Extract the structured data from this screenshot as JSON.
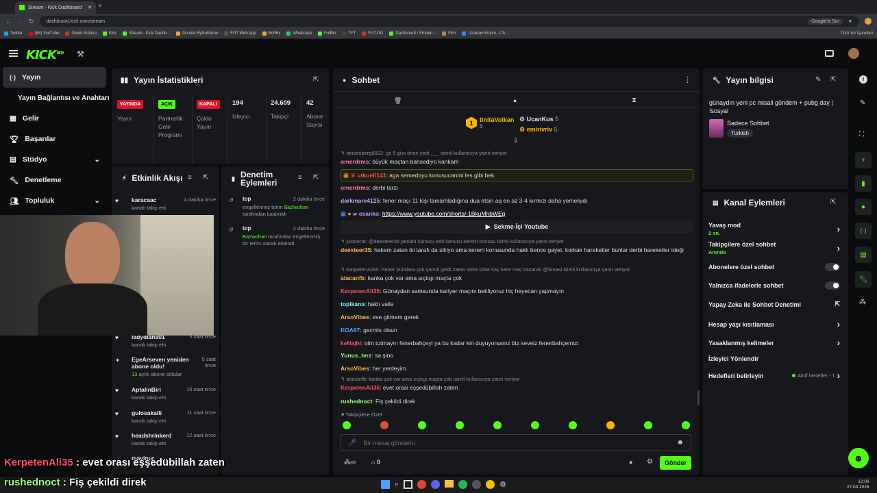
{
  "browser": {
    "tab_title": "Stream - Kick Dashboard",
    "url": "dashboard.kick.com/stream",
    "google_label": "Google'a Sor",
    "bookmarks": [
      "Twitter",
      "(88) YouTube",
      "Gelen Kutusu",
      "Kick",
      "Stream - Kick Dashb...",
      "Donate ByNoGame",
      "FUT Web App",
      "BotRix",
      "WhatsApp",
      "FutBin",
      "TFT",
      "FUT.GG",
      "Dashboard / Stream...",
      "Film",
      "Uzaktan Erişim - Ch..."
    ],
    "all_bookmarks": "Tüm Yer İşaretleri"
  },
  "app": {
    "logo": "KICK",
    "logo_sup": "BETA"
  },
  "sidebar": {
    "items": [
      {
        "label": "Yayın"
      },
      {
        "label": "Yayın Bağlantısı ve Anahtarı"
      },
      {
        "label": "Gelir"
      },
      {
        "label": "Başarılar"
      },
      {
        "label": "Stüdyo"
      },
      {
        "label": "Denetleme"
      },
      {
        "label": "Topluluk"
      }
    ]
  },
  "stats": {
    "title": "Yayın İstatistikleri",
    "cols": [
      {
        "badge": "YAYINDA",
        "label": "Yayın"
      },
      {
        "badge": "AÇIK",
        "label": "Partnerlik Gelir Programı"
      },
      {
        "badge": "KAPALI",
        "label": "Çoklu Yayın"
      },
      {
        "value": "194",
        "label": "İzleyici"
      },
      {
        "value": "24.609",
        "label": "Takipçi"
      },
      {
        "value": "42",
        "label": "Abone Sayısı"
      }
    ]
  },
  "activity": {
    "title": "Etkinlik Akışı",
    "items": [
      {
        "name": "karacaac",
        "sub": "kanalı takip etti",
        "time": "4 dakika önce"
      },
      {
        "name": "ladydiana01",
        "sub": "kanalı takip etti",
        "time": "3 saat önce"
      },
      {
        "name": "EgeArseven yeniden abone oldu!",
        "count": "13",
        "sub": "aylık abone oldular",
        "time": "5 saat önce"
      },
      {
        "name": "AptalinBiri",
        "sub": "kanalı takip etti",
        "time": "10 saat önce"
      },
      {
        "name": "gulosakalli",
        "sub": "kanalı takip etti",
        "time": "11 saat önce"
      },
      {
        "name": "headshrinkerd",
        "sub": "kanalı takip etti",
        "time": "12 saat önce"
      },
      {
        "name": "mavinur",
        "sub": "",
        "time": ""
      }
    ]
  },
  "moderation": {
    "title": "Denetim Eylemleri",
    "items": [
      {
        "name": "top",
        "time": "2 dakika önce",
        "pre": "engellenmiş terim ",
        "user": "Ba2wohan",
        "post": " tarafından kaldırıldı"
      },
      {
        "name": "top",
        "time": "2 dakika önce",
        "pre": "",
        "user": "Ba2wohan",
        "post": " tarafından engellenmiş bir terim olarak eklendi"
      }
    ]
  },
  "chat": {
    "title": "Sohbet",
    "top_users": [
      {
        "name": "tinitaVolkan",
        "count": "6"
      },
      {
        "name": "UcanKus",
        "count": "5"
      },
      {
        "name": "emirivriv",
        "count": "5"
      }
    ],
    "messages": [
      {
        "reply": "heisenberg8922: gs 5 gün önce yedi ___ isimli kullanıcıya yanıt veriyor"
      },
      {
        "user": "omerdrms",
        "color": "#ff7aa8",
        "text": "büyük maçtan bahsediyo kankam"
      },
      {
        "user": "utkuefi141",
        "color": "#ff4d6a",
        "text": "aga semedoyu konusucanmi les gibi bek",
        "highlight": true
      },
      {
        "user": "omerdrms",
        "color": "#ff7aa8",
        "text": "derbi tarzı"
      },
      {
        "user": "darkmare4125",
        "color": "#b9a7ff",
        "text": "fener maçı 11 kişi tamamladığına dua etsin aq en az 3-4 kırmızı daha yemeliydi"
      },
      {
        "user": "esanko",
        "color": "#d18cff",
        "text": "https://www.youtube.com/shorts/-1BkuMhbWEg"
      },
      {
        "embed": "Sekme-İçi Youtube"
      },
      {
        "reply": "justserat: @deexteer35 penaltı konusu edit konusu kerem konusu isimli kullanıcıya yanıt veriyor"
      },
      {
        "user": "deexteer35",
        "color": "#ffb84d",
        "text": "hakem zaten iki tarafı da sikiyo ama kerem konusunda haklı bence gayet. korkak hareketler bunlar derbi hareketler ideği"
      },
      {
        "reply": "KerpetenAli35: Fener buralara çok şansli geldi zaten söke söke kaç kere maç kazandı @Sinasi isimli kullanıcıya yanıt veriyor"
      },
      {
        "user": "atacanfb",
        "color": "#ffb84d",
        "text": "kanka çok var ama sıçtıgı maçta çok"
      },
      {
        "user": "KerpetenAli35",
        "color": "#ff4d6a",
        "text": "Günaydan samsunda kariyer maçını bekliyoruz hiç heyecan yapmayın"
      },
      {
        "user": "topikana",
        "color": "#7cf7ff",
        "text": "haklı valla"
      },
      {
        "user": "ArsoVibes",
        "color": "#ffb84d",
        "text": "eve gitmem gerek"
      },
      {
        "user": "KOA97",
        "color": "#4da6ff",
        "text": "gecmis olsun"
      },
      {
        "user": "keNajhi",
        "color": "#ff4d6a",
        "text": "olm tutmayın fenerbahçeyi ya bu kadar kin duyuyorsanız biz seveiz fenerbahçemizi"
      },
      {
        "user": "Yunus_terz",
        "color": "#9dff7a",
        "text": "sa şino"
      },
      {
        "user": "ArsoVibes",
        "color": "#ffb84d",
        "text": "her yerdeyim"
      },
      {
        "reply": "atacanfb: kanka çok var ama sıçtıgı maçta çok isimli kullanıcıya yanıt veriyor"
      },
      {
        "user": "KerpetenAli35",
        "color": "#ff4d6a",
        "text": "evet orasi eşşedübillah zaten"
      },
      {
        "user": "rushednoct",
        "color": "#9dff7a",
        "text": "Fiş çekildi direk"
      }
    ],
    "followers_only": "Takipçilere Özel",
    "input_placeholder": "Bir mesaj gönderin",
    "points": "0",
    "send_label": "Gönder"
  },
  "stream_info": {
    "title": "Yayın bilgisi",
    "stream_title": "günaydın yeni pc misali gündem + pubg day | !sosyal",
    "category": "Sadece Sohbet",
    "tag": "Turkish"
  },
  "channel_actions": {
    "title": "Kanal Eylemleri",
    "items": [
      {
        "label": "Yavaş mod",
        "sub": "2 sn."
      },
      {
        "label": "Takipçilere özel sohbet",
        "sub": "Anında"
      },
      {
        "label": "Abonelere özel sohbet"
      },
      {
        "label": "Yalnızca ifadelerle sohbet"
      },
      {
        "label": "Yapay Zeka ile Sohbet Denetimi"
      },
      {
        "label": "Hesap yaşı kısıtlaması"
      },
      {
        "label": "Yasaklanmış kelimeler"
      },
      {
        "label": "İzleyici Yönlendir"
      },
      {
        "label": "Hedefleri belirleyin",
        "sub": "Aktif hedefler - 1"
      }
    ]
  },
  "captions": [
    {
      "user": "KerpetenAli35",
      "text": " : evet orası eşşedübillah zaten"
    },
    {
      "user": "rushednoct",
      "text": " : Fiş çekildi direk"
    }
  ],
  "taskbar": {
    "time": "12:06",
    "date": "27.04.2026"
  },
  "colors": {
    "accent": "#53fc18",
    "live_red": "#e0112b",
    "panel": "#17181b",
    "bg": "#0b0c0d"
  }
}
